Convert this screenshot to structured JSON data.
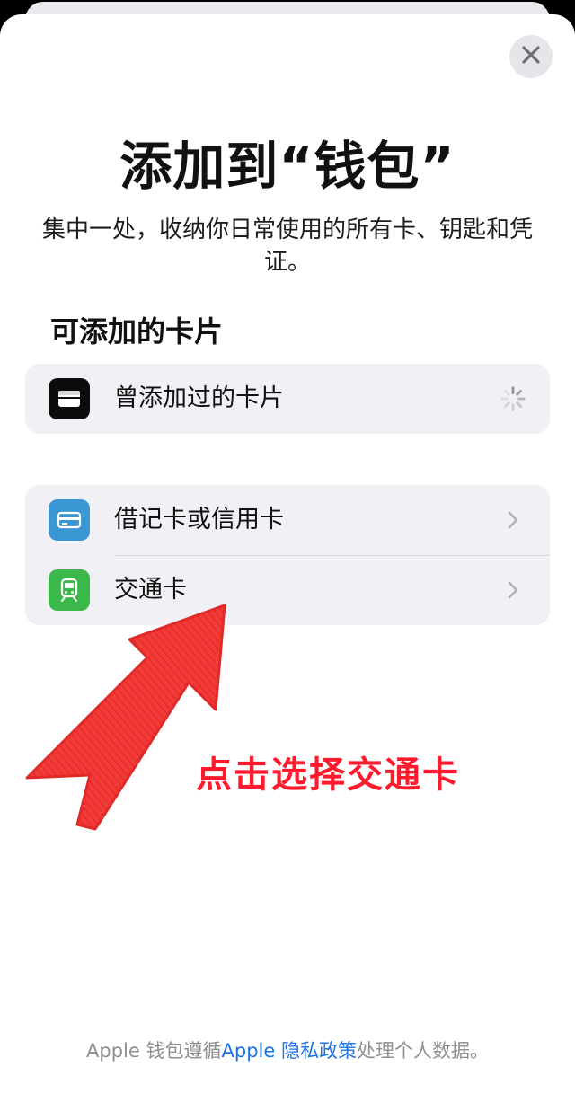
{
  "header": {
    "close_icon": "xmark-icon",
    "title": "添加到“钱包”",
    "subtitle": "集中一处，收纳你日常使用的所有卡、钥匙和凭证。"
  },
  "section": {
    "title": "可添加的卡片"
  },
  "previous_cards": {
    "label": "曾添加过的卡片",
    "icon": "wallet-icon",
    "status": "loading-spinner-icon"
  },
  "card_types": [
    {
      "label": "借记卡或信用卡",
      "icon": "credit-card-icon",
      "icon_color": "#3b97d3"
    },
    {
      "label": "交通卡",
      "icon": "train-icon",
      "icon_color": "#3cb84a"
    }
  ],
  "annotation": {
    "text": "点击选择交通卡",
    "color": "#ff1a2e"
  },
  "footer": {
    "prefix": "Apple 钱包遵循",
    "link": "Apple 隐私政策",
    "suffix": "处理个人数据。"
  },
  "colors": {
    "link": "#1a73e8",
    "group_background": "#f0f0f5"
  }
}
